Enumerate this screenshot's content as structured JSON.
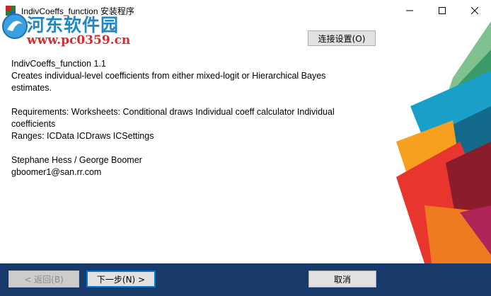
{
  "window": {
    "title": "IndivCoeffs_function 安装程序"
  },
  "watermark": {
    "site_name": "河东软件园",
    "url": "www.pc0359.cn"
  },
  "connection_button_label": "连接设置(O)",
  "description": {
    "line1": "IndivCoeffs_function 1.1",
    "line2": "Creates individual-level coefficients from either mixed-logit or Hierarchical Bayes",
    "line3": "estimates.",
    "line4": "Requirements: Worksheets: Conditional draws Individual coeff calculator Individual",
    "line5": "coefficients",
    "line6": "Ranges: ICData ICDraws ICSettings",
    "line7": "Stephane Hess / George Boomer",
    "line8": "gboomer1@san.rr.com"
  },
  "footer": {
    "back_label": "< 返回(B)",
    "next_label": "下一步(N) >",
    "cancel_label": "取消"
  },
  "colors": {
    "footer_bg": "#173a6b",
    "accent_blue": "#0078d7"
  }
}
